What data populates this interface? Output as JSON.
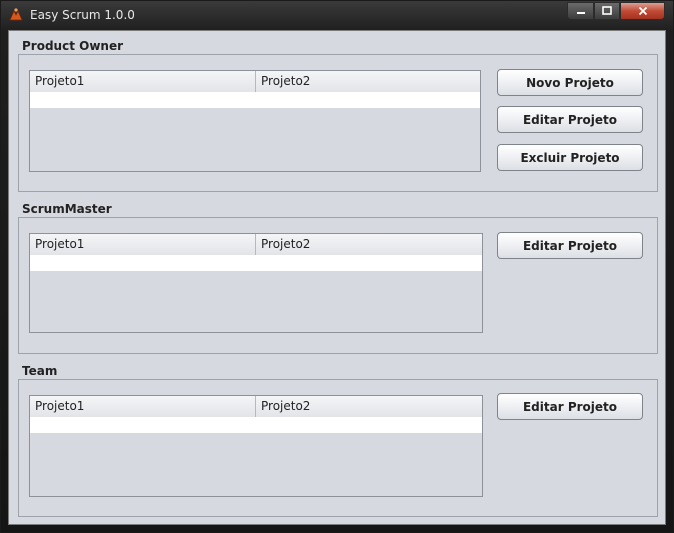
{
  "window": {
    "title": "Easy Scrum 1.0.0",
    "app_icon": "easy-scrum-icon",
    "controls": {
      "minimize": "minimize-icon",
      "maximize": "maximize-icon",
      "close": "close-icon"
    }
  },
  "sections": [
    {
      "title": "Product Owner",
      "table": {
        "columns": [
          "Projeto1",
          "Projeto2"
        ],
        "rows": []
      },
      "buttons": [
        "Novo Projeto",
        "Editar Projeto",
        "Excluir Projeto"
      ]
    },
    {
      "title": "ScrumMaster",
      "table": {
        "columns": [
          "Projeto1",
          "Projeto2"
        ],
        "rows": []
      },
      "buttons": [
        "Editar Projeto"
      ]
    },
    {
      "title": "Team",
      "table": {
        "columns": [
          "Projeto1",
          "Projeto2"
        ],
        "rows": []
      },
      "buttons": [
        "Editar Projeto"
      ]
    }
  ]
}
